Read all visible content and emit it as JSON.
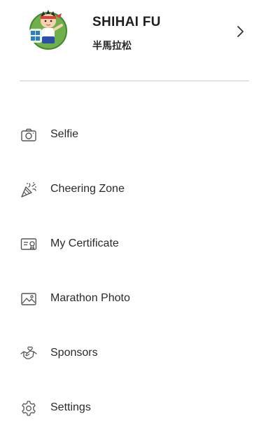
{
  "profile": {
    "name": "SHIHAI FU",
    "event": "半馬拉松"
  },
  "menu": {
    "items": [
      {
        "label": "Selfie",
        "icon": "camera-icon"
      },
      {
        "label": "Cheering Zone",
        "icon": "confetti-icon"
      },
      {
        "label": "My Certificate",
        "icon": "certificate-icon"
      },
      {
        "label": "Marathon Photo",
        "icon": "photo-icon"
      },
      {
        "label": "Sponsors",
        "icon": "handshake-icon"
      },
      {
        "label": "Settings",
        "icon": "gear-icon"
      }
    ]
  },
  "colors": {
    "text": "#2b2b2b",
    "icon_stroke": "#555555",
    "divider": "#cfcfcf",
    "avatar_bg": "#6fb04a"
  }
}
